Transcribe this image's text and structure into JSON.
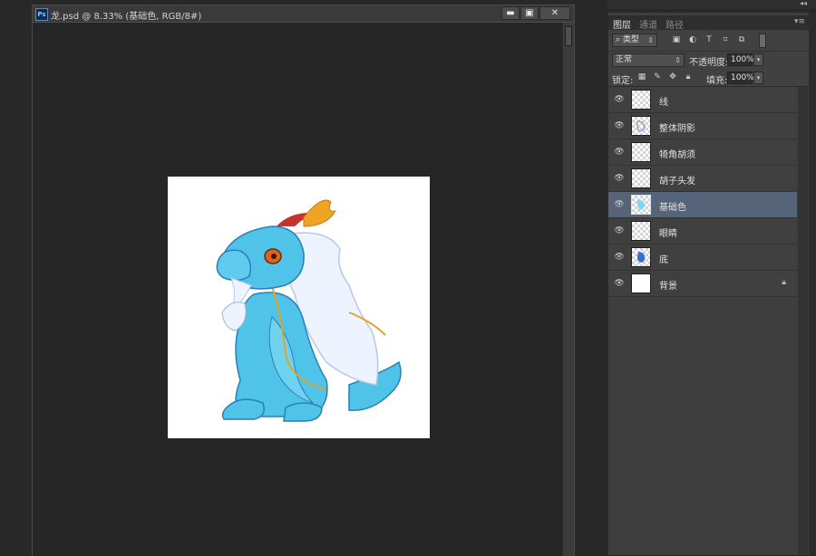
{
  "document": {
    "title": "龙.psd @ 8.33% (基础色, RGB/8#)",
    "app_badge": "Ps",
    "buttons": {
      "minimize": "▬",
      "maximize": "▣",
      "close": "✕"
    }
  },
  "layers_panel": {
    "tabs": [
      {
        "label": "图层",
        "active": true
      },
      {
        "label": "通道",
        "active": false
      },
      {
        "label": "路径",
        "active": false
      }
    ],
    "filter_kind": "类型",
    "blend_mode": "正常",
    "opacity_label": "不透明度:",
    "opacity_value": "100%",
    "lock_label": "锁定:",
    "fill_label": "填充:",
    "fill_value": "100%",
    "layers": [
      {
        "name": "线",
        "thumb": "transparent",
        "selected": false
      },
      {
        "name": "整体阴影",
        "thumb": "transparent-sketch",
        "selected": false
      },
      {
        "name": "犄角胡须",
        "thumb": "transparent",
        "selected": false
      },
      {
        "name": "胡子头发",
        "thumb": "transparent",
        "selected": false
      },
      {
        "name": "基础色",
        "thumb": "cyan-fill",
        "selected": true
      },
      {
        "name": "眼睛",
        "thumb": "transparent",
        "selected": false
      },
      {
        "name": "底",
        "thumb": "blue-fill",
        "selected": false
      },
      {
        "name": "背景",
        "thumb": "white",
        "selected": false,
        "locked": true
      }
    ]
  },
  "colors": {
    "dragon_body": "#4fc3e8",
    "dragon_dark": "#2a8fc7",
    "hair": "#eef4ff",
    "horn_red": "#c8322a",
    "horn_gold": "#f0a424",
    "selected_layer": "#56647a"
  }
}
